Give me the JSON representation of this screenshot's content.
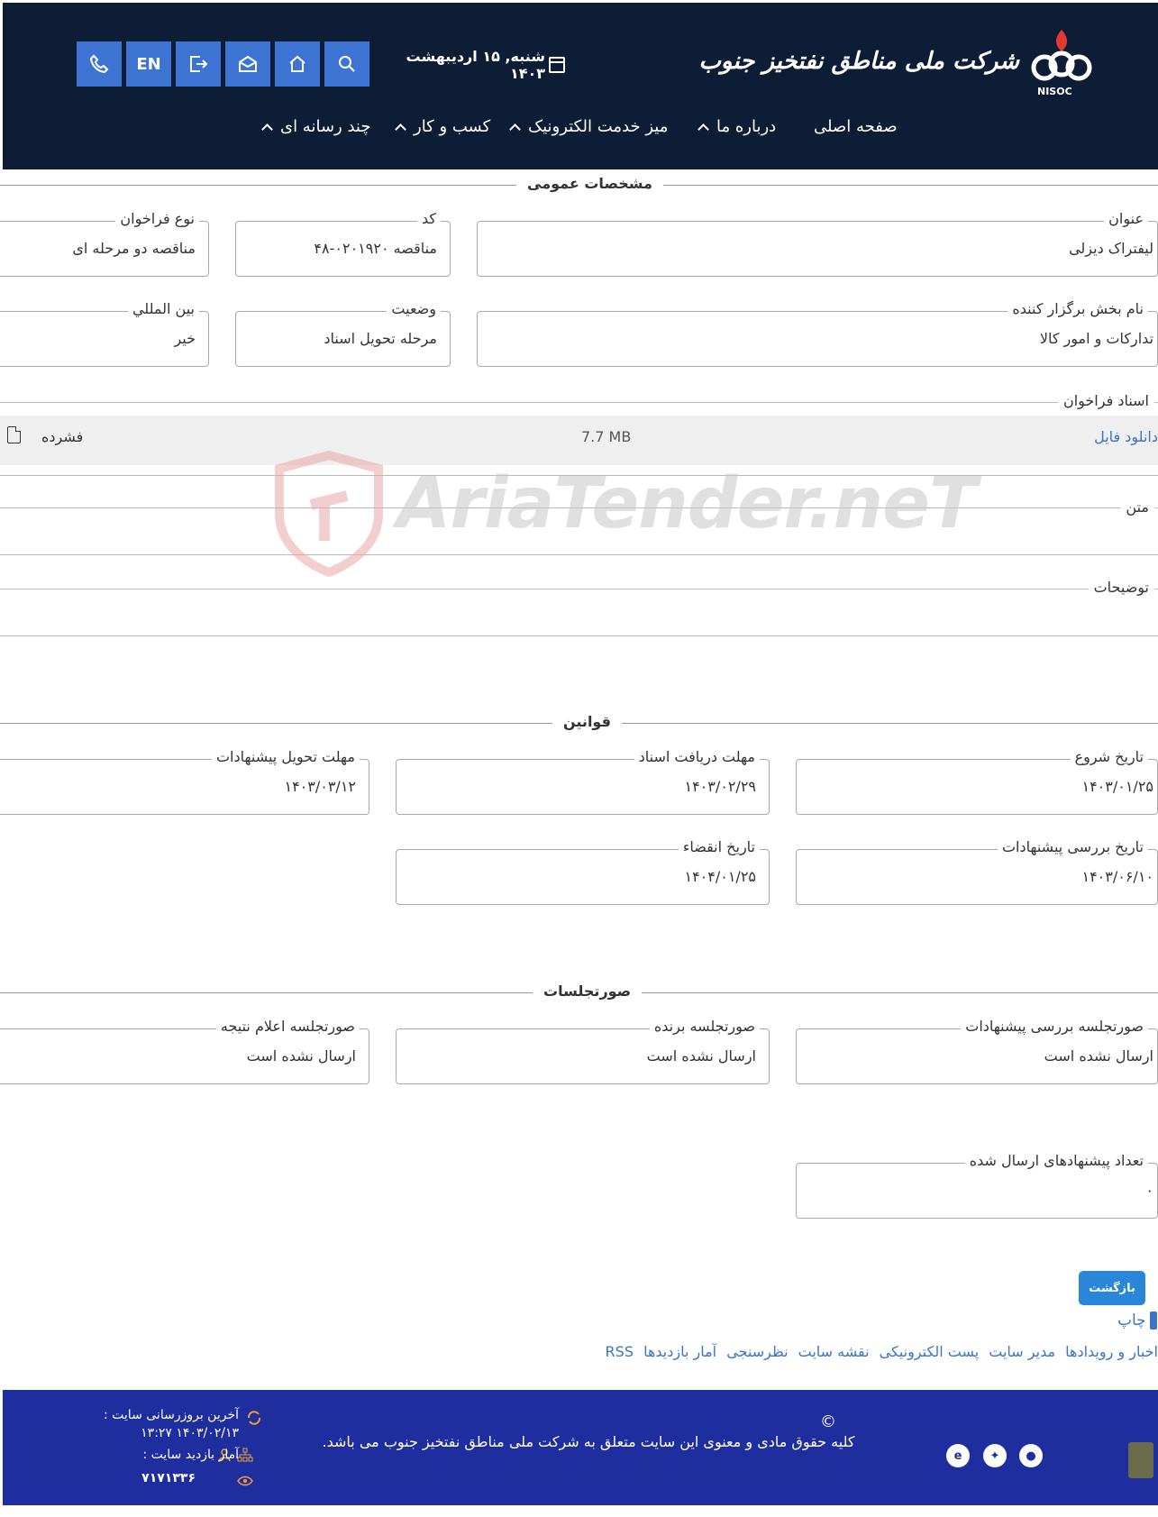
{
  "header": {
    "logo_text": "شرکت ملی مناطق نفتخیز جنوب",
    "logo_abbr": "NISOC",
    "date": "شنبه, ۱۵ اردیبهشت ۱۴۰۳",
    "lang_label": "EN",
    "nav": [
      {
        "label": "صفحه اصلی",
        "has_chevron": false
      },
      {
        "label": "درباره ما",
        "has_chevron": true
      },
      {
        "label": "میز خدمت الکترونیک",
        "has_chevron": true
      },
      {
        "label": "کسب و کار",
        "has_chevron": true
      },
      {
        "label": "چند رسانه ای",
        "has_chevron": true
      }
    ]
  },
  "general": {
    "title": "مشخصات عمومی",
    "fields": {
      "subject_label": "عنوان",
      "subject_value": "لیفتراک دیزلی",
      "code_label": "کد",
      "code_value": "مناقصه ۰۲۰۱۹۲۰-۴۸",
      "type_label": "نوع فراخوان",
      "type_value": "مناقصه دو مرحله ای",
      "dept_label": "نام بخش برگزار کننده",
      "dept_value": "تدارکات و امور کالا",
      "status_label": "وضعیت",
      "status_value": "مرحله تحویل اسناد",
      "intl_label": "بين المللي",
      "intl_value": "خیر"
    },
    "docs_label": "اسناد فراخوان",
    "attachment": {
      "link": "دانلود فایل",
      "size": "7.7 MB",
      "type": "فشرده"
    },
    "text_label": "متن",
    "desc_label": "توضیحات"
  },
  "rules": {
    "title": "قوانین",
    "start_label": "تاریخ شروع",
    "start_value": "۱۴۰۳/۰۱/۲۵",
    "docs_deadline_label": "مهلت دریافت اسناد",
    "docs_deadline_value": "۱۴۰۳/۰۲/۲۹",
    "offer_deadline_label": "مهلت تحویل پیشنهادات",
    "offer_deadline_value": "۱۴۰۳/۰۳/۱۲",
    "review_label": "تاریخ بررسی پیشنهادات",
    "review_value": "۱۴۰۳/۰۶/۱۰",
    "expire_label": "تاریخ انقضاء",
    "expire_value": "۱۴۰۴/۰۱/۲۵"
  },
  "minutes": {
    "title": "صورتجلسات",
    "review_label": "صورتجلسه بررسی پیشنهادات",
    "review_value": "ارسال نشده است",
    "winner_label": "صورتجلسه برنده",
    "winner_value": "ارسال نشده است",
    "result_label": "صورتجلسه اعلام نتیجه",
    "result_value": "ارسال نشده است",
    "count_label": "تعداد پیشنهادهای ارسال شده",
    "count_value": "۰"
  },
  "actions": {
    "back_label": "بازگشت",
    "print_label": "چاپ",
    "footer_links": [
      "اخبار و رویدادها",
      "مدیر سایت",
      "پست الکترونیکی",
      "نقشه سایت",
      "نظرسنجی",
      "آمار بازدیدها",
      "RSS"
    ]
  },
  "watermark": "AriaTender.neT",
  "footer": {
    "copyright_symbol": "©",
    "copyright": "کلیه حقوق مادی و معنوی این سایت متعلق به شرکت ملی مناطق نفتخیز جنوب می باشد.",
    "last_update_label": "آخرین بروزرسانی سایت :",
    "last_update_value": "۱۴۰۳/۰۲/۱۳ ۱۳:۲۷",
    "visits_label": "آمار بازدید سایت :",
    "visits_value": "۷۱۷۱۳۳۶"
  },
  "colors": {
    "header_bg": "#0e1d36",
    "icon_btn": "#3d74d4",
    "link": "#3b75c6",
    "footer_bg": "#1e2e9e",
    "back_btn": "#2a86d9"
  }
}
